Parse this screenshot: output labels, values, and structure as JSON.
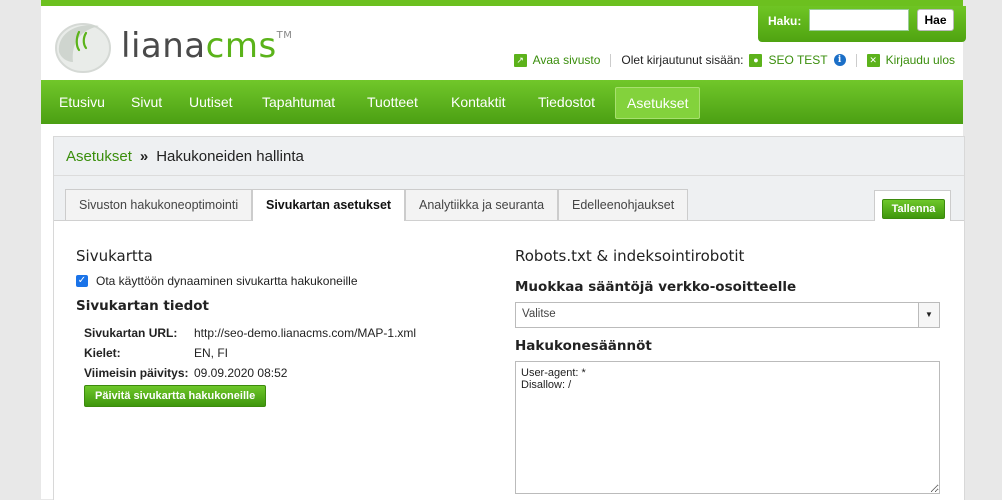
{
  "logo": {
    "text_main": "liana",
    "text_brand": "cms",
    "trademark": "TM"
  },
  "search": {
    "label": "Haku:",
    "value": "",
    "button": "Hae"
  },
  "userbar": {
    "open_site": "Avaa sivusto",
    "logged_in_text": "Olet kirjautunut sisään:",
    "user_name": "SEO TEST",
    "logout": "Kirjaudu ulos"
  },
  "nav": {
    "items": [
      {
        "label": "Etusivu",
        "active": false
      },
      {
        "label": "Sivut",
        "active": false
      },
      {
        "label": "Uutiset",
        "active": false
      },
      {
        "label": "Tapahtumat",
        "active": false
      },
      {
        "label": "Tuotteet",
        "active": false
      },
      {
        "label": "Kontaktit",
        "active": false
      },
      {
        "label": "Tiedostot",
        "active": false
      },
      {
        "label": "Asetukset",
        "active": true
      }
    ]
  },
  "breadcrumb": {
    "parent": "Asetukset",
    "separator": "»",
    "current": "Hakukoneiden hallinta"
  },
  "tabs": [
    {
      "label": "Sivuston hakukoneoptimointi",
      "active": false
    },
    {
      "label": "Sivukartan asetukset",
      "active": true
    },
    {
      "label": "Analytiikka ja seuranta",
      "active": false
    },
    {
      "label": "Edelleenohjaukset",
      "active": false
    }
  ],
  "save_button": "Tallenna",
  "sitemap": {
    "heading": "Sivukartta",
    "checkbox_label": "Ota käyttöön dynaaminen sivukartta hakukoneille",
    "checkbox_checked": true,
    "details_heading": "Sivukartan tiedot",
    "rows": [
      {
        "key": "Sivukartan URL:",
        "value": "http://seo-demo.lianacms.com/MAP-1.xml"
      },
      {
        "key": "Kielet:",
        "value": "EN, FI"
      },
      {
        "key": "Viimeisin päivitys:",
        "value": "09.09.2020 08:52"
      }
    ],
    "update_button": "Päivitä sivukartta hakukoneille"
  },
  "robots": {
    "heading": "Robots.txt & indeksointirobotit",
    "edit_rules_heading": "Muokkaa sääntöjä verkko-osoitteelle",
    "select_value": "Valitse",
    "rules_heading": "Hakukonesäännöt",
    "rules_text": "User-agent: *\nDisallow: /"
  },
  "colors": {
    "brand_green": "#5bb31a",
    "link_green": "#3a8e0c",
    "info_blue": "#1b6fc7"
  }
}
